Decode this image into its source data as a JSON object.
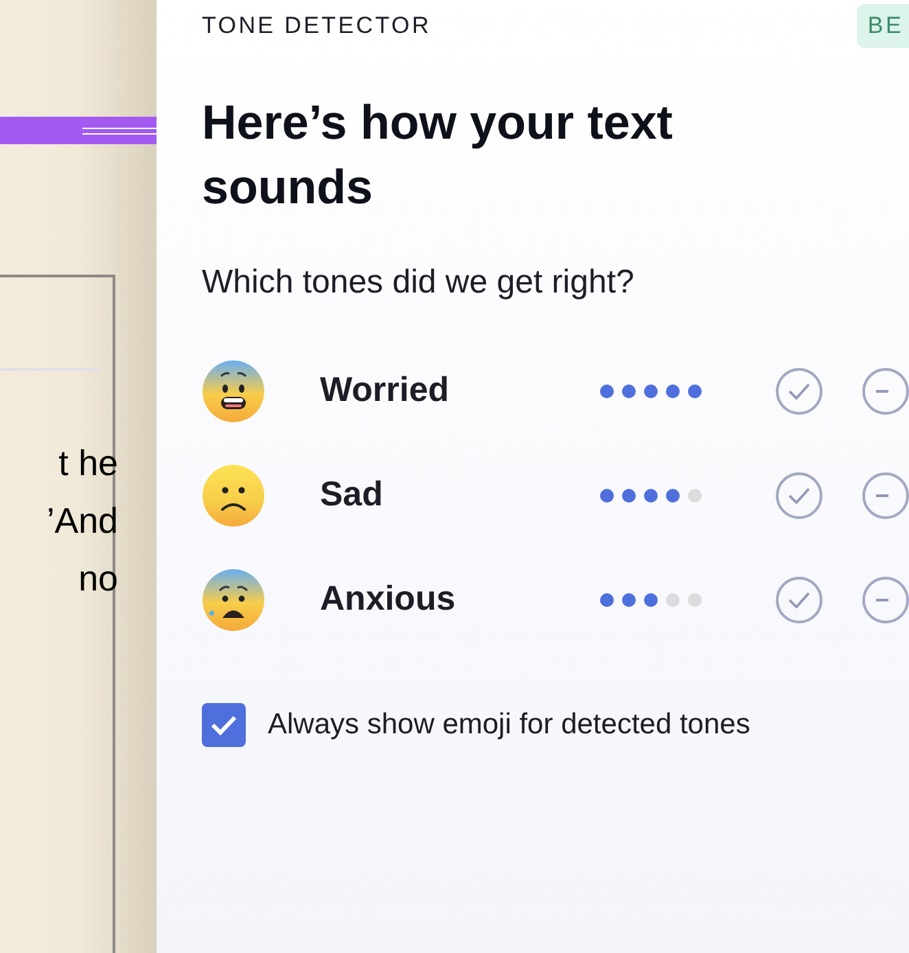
{
  "document": {
    "lines": [
      "t he",
      "’And",
      "no"
    ]
  },
  "panel": {
    "eyebrow": "TONE DETECTOR",
    "badge": "BE",
    "title": "Here’s how your text sounds",
    "question": "Which tones did we get right?",
    "tones": [
      {
        "kind": "worried",
        "label": "Worried",
        "stars": 5
      },
      {
        "kind": "sad",
        "label": "Sad",
        "stars": 4
      },
      {
        "kind": "anxious",
        "label": "Anxious",
        "stars": 3
      }
    ],
    "always_show_emoji": {
      "label": "Always show emoji for detected tones",
      "checked": true
    }
  }
}
